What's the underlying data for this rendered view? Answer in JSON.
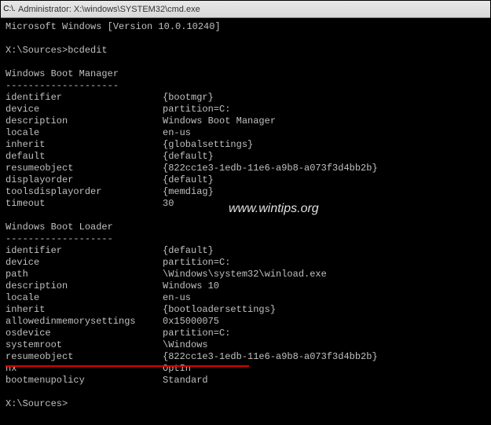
{
  "titlebar": {
    "icon_text": "C:\\.",
    "title": "Administrator: X:\\windows\\SYSTEM32\\cmd.exe"
  },
  "terminal": {
    "header_line": "Microsoft Windows [Version 10.0.10240]",
    "prompt1": "X:\\Sources>",
    "command1": "bcdedit",
    "section1_title": "Windows Boot Manager",
    "section1_dash": "--------------------",
    "section1": {
      "identifier": {
        "k": "identifier",
        "v": "{bootmgr}"
      },
      "device": {
        "k": "device",
        "v": "partition=C:"
      },
      "description": {
        "k": "description",
        "v": "Windows Boot Manager"
      },
      "locale": {
        "k": "locale",
        "v": "en-us"
      },
      "inherit": {
        "k": "inherit",
        "v": "{globalsettings}"
      },
      "default": {
        "k": "default",
        "v": "{default}"
      },
      "resumeobject": {
        "k": "resumeobject",
        "v": "{822cc1e3-1edb-11e6-a9b8-a073f3d4bb2b}"
      },
      "displayorder": {
        "k": "displayorder",
        "v": "{default}"
      },
      "toolsdisplayorder": {
        "k": "toolsdisplayorder",
        "v": "{memdiag}"
      },
      "timeout": {
        "k": "timeout",
        "v": "30"
      }
    },
    "section2_title": "Windows Boot Loader",
    "section2_dash": "-------------------",
    "section2": {
      "identifier": {
        "k": "identifier",
        "v": "{default}"
      },
      "device": {
        "k": "device",
        "v": "partition=C:"
      },
      "path": {
        "k": "path",
        "v": "\\Windows\\system32\\winload.exe"
      },
      "description": {
        "k": "description",
        "v": "Windows 10"
      },
      "locale": {
        "k": "locale",
        "v": "en-us"
      },
      "inherit": {
        "k": "inherit",
        "v": "{bootloadersettings}"
      },
      "allowedinmemorysettings": {
        "k": "allowedinmemorysettings",
        "v": "0x15000075"
      },
      "osdevice": {
        "k": "osdevice",
        "v": "partition=C:"
      },
      "systemroot": {
        "k": "systemroot",
        "v": "\\Windows"
      },
      "resumeobject": {
        "k": "resumeobject",
        "v": "{822cc1e3-1edb-11e6-a9b8-a073f3d4bb2b}"
      },
      "nx": {
        "k": "nx",
        "v": "OptIn"
      },
      "bootmenupolicy": {
        "k": "bootmenupolicy",
        "v": "Standard"
      }
    },
    "prompt2": "X:\\Sources>"
  },
  "watermark": "www.wintips.org"
}
